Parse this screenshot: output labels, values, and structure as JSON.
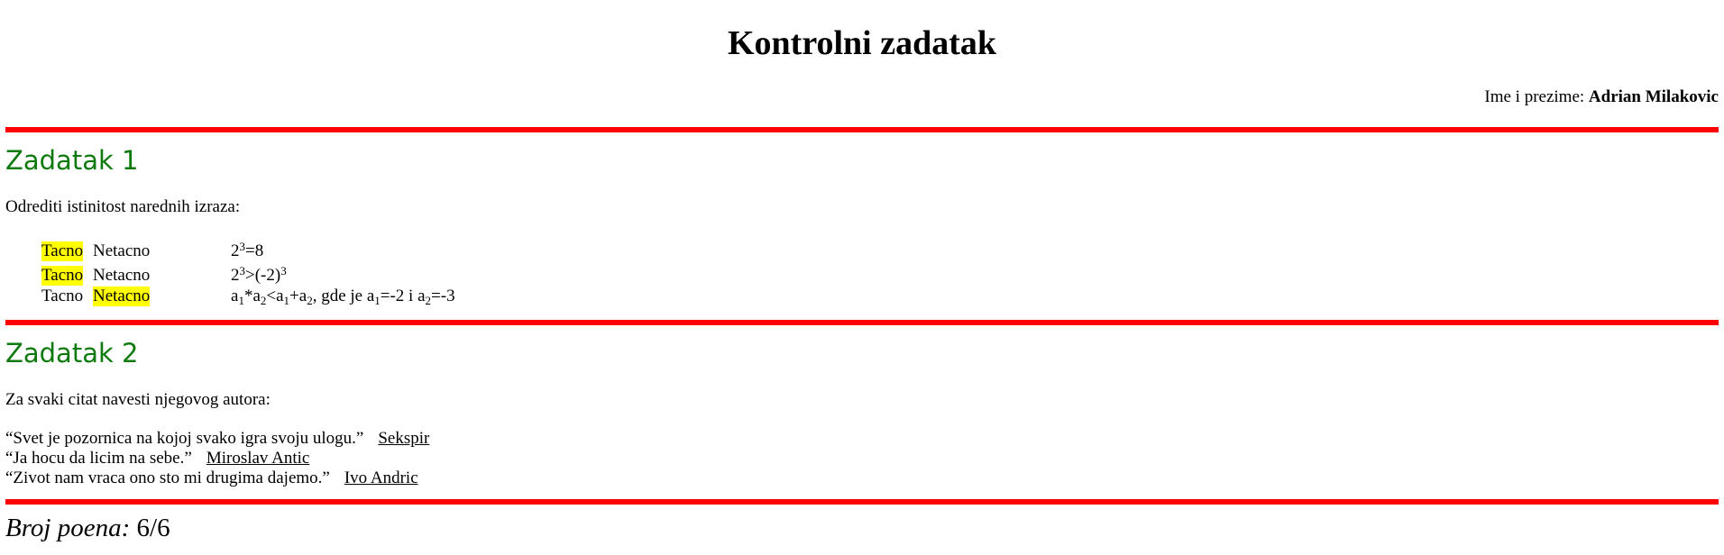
{
  "title": "Kontrolni zadatak",
  "student": {
    "label": "Ime i prezime:",
    "name": "Adrian Milakovic"
  },
  "task1": {
    "title": "Zadatak 1",
    "instruction": "Odrediti istinitost narednih izraza:",
    "true_label": "Tacno",
    "false_label": "Netacno",
    "rows": [
      {
        "selected": "Tacno",
        "expr_parts": [
          "2",
          "3",
          "=8"
        ]
      },
      {
        "selected": "Tacno",
        "expr_parts": [
          "2",
          "3",
          ">(-2)",
          "3"
        ]
      },
      {
        "selected": "Netacno",
        "expr_parts": [
          "a",
          "1",
          "*a",
          "2",
          "<a",
          "1",
          "+a",
          "2",
          ", gde je a",
          "1",
          "=-2 i a",
          "2",
          "=-3"
        ]
      }
    ]
  },
  "task2": {
    "title": "Zadatak 2",
    "instruction": "Za svaki citat navesti njegovog autora:",
    "quotes": [
      {
        "text": "“Svet je pozornica na kojoj svako igra svoju ulogu.”",
        "author": "Sekspir"
      },
      {
        "text": "“Ja hocu da licim na sebe.”",
        "author": "Miroslav Antic"
      },
      {
        "text": "“Zivot nam vraca ono sto mi drugima dajemo.”",
        "author": "Ivo Andric"
      }
    ]
  },
  "score": {
    "label": "Broj poena:",
    "value": "6/6"
  },
  "colors": {
    "rule": "#ff0000",
    "heading": "#0e7a0e",
    "highlight": "#ffff00"
  }
}
